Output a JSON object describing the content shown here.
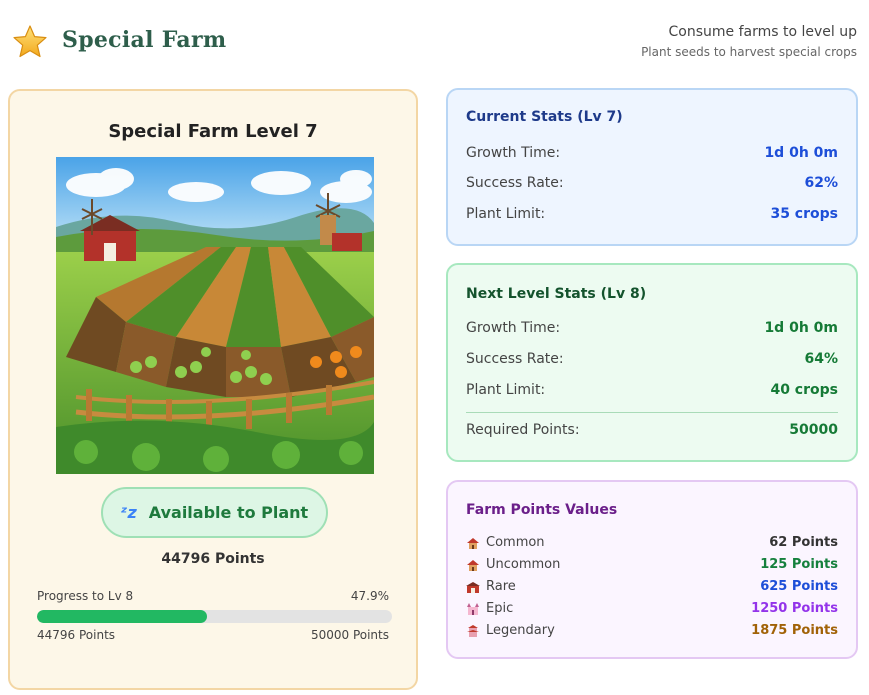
{
  "header": {
    "brand": "Special Farm",
    "line1": "Consume farms to level up",
    "line2": "Plant seeds to harvest special crops"
  },
  "farm": {
    "title": "Special Farm Level 7",
    "plant_button": "Available to Plant",
    "points_total": "44796 Points",
    "progress_label": "Progress to Lv 8",
    "progress_pct_text": "47.9%",
    "progress_fraction": 0.479,
    "progress_current": "44796 Points",
    "progress_target": "50000 Points"
  },
  "current": {
    "title": "Current Stats (Lv 7)",
    "rows": [
      {
        "label": "Growth Time:",
        "value": "1d 0h 0m"
      },
      {
        "label": "Success Rate:",
        "value": "62%"
      },
      {
        "label": "Plant Limit:",
        "value": "35 crops"
      }
    ]
  },
  "next": {
    "title": "Next Level Stats (Lv 8)",
    "rows": [
      {
        "label": "Growth Time:",
        "value": "1d 0h 0m"
      },
      {
        "label": "Success Rate:",
        "value": "64%"
      },
      {
        "label": "Plant Limit:",
        "value": "40 crops"
      }
    ],
    "required_label": "Required Points:",
    "required_value": "50000"
  },
  "farm_points": {
    "title": "Farm Points Values",
    "rows": [
      {
        "label": "Common",
        "value": "62 Points",
        "color": "#333333",
        "icon": "house-icon"
      },
      {
        "label": "Uncommon",
        "value": "125 Points",
        "color": "#15803d",
        "icon": "house-icon"
      },
      {
        "label": "Rare",
        "value": "625 Points",
        "color": "#1d4ed8",
        "icon": "barn-icon"
      },
      {
        "label": "Epic",
        "value": "1250 Points",
        "color": "#9333ea",
        "icon": "castle-icon"
      },
      {
        "label": "Legendary",
        "value": "1875 Points",
        "color": "#a16207",
        "icon": "temple-icon"
      }
    ]
  }
}
